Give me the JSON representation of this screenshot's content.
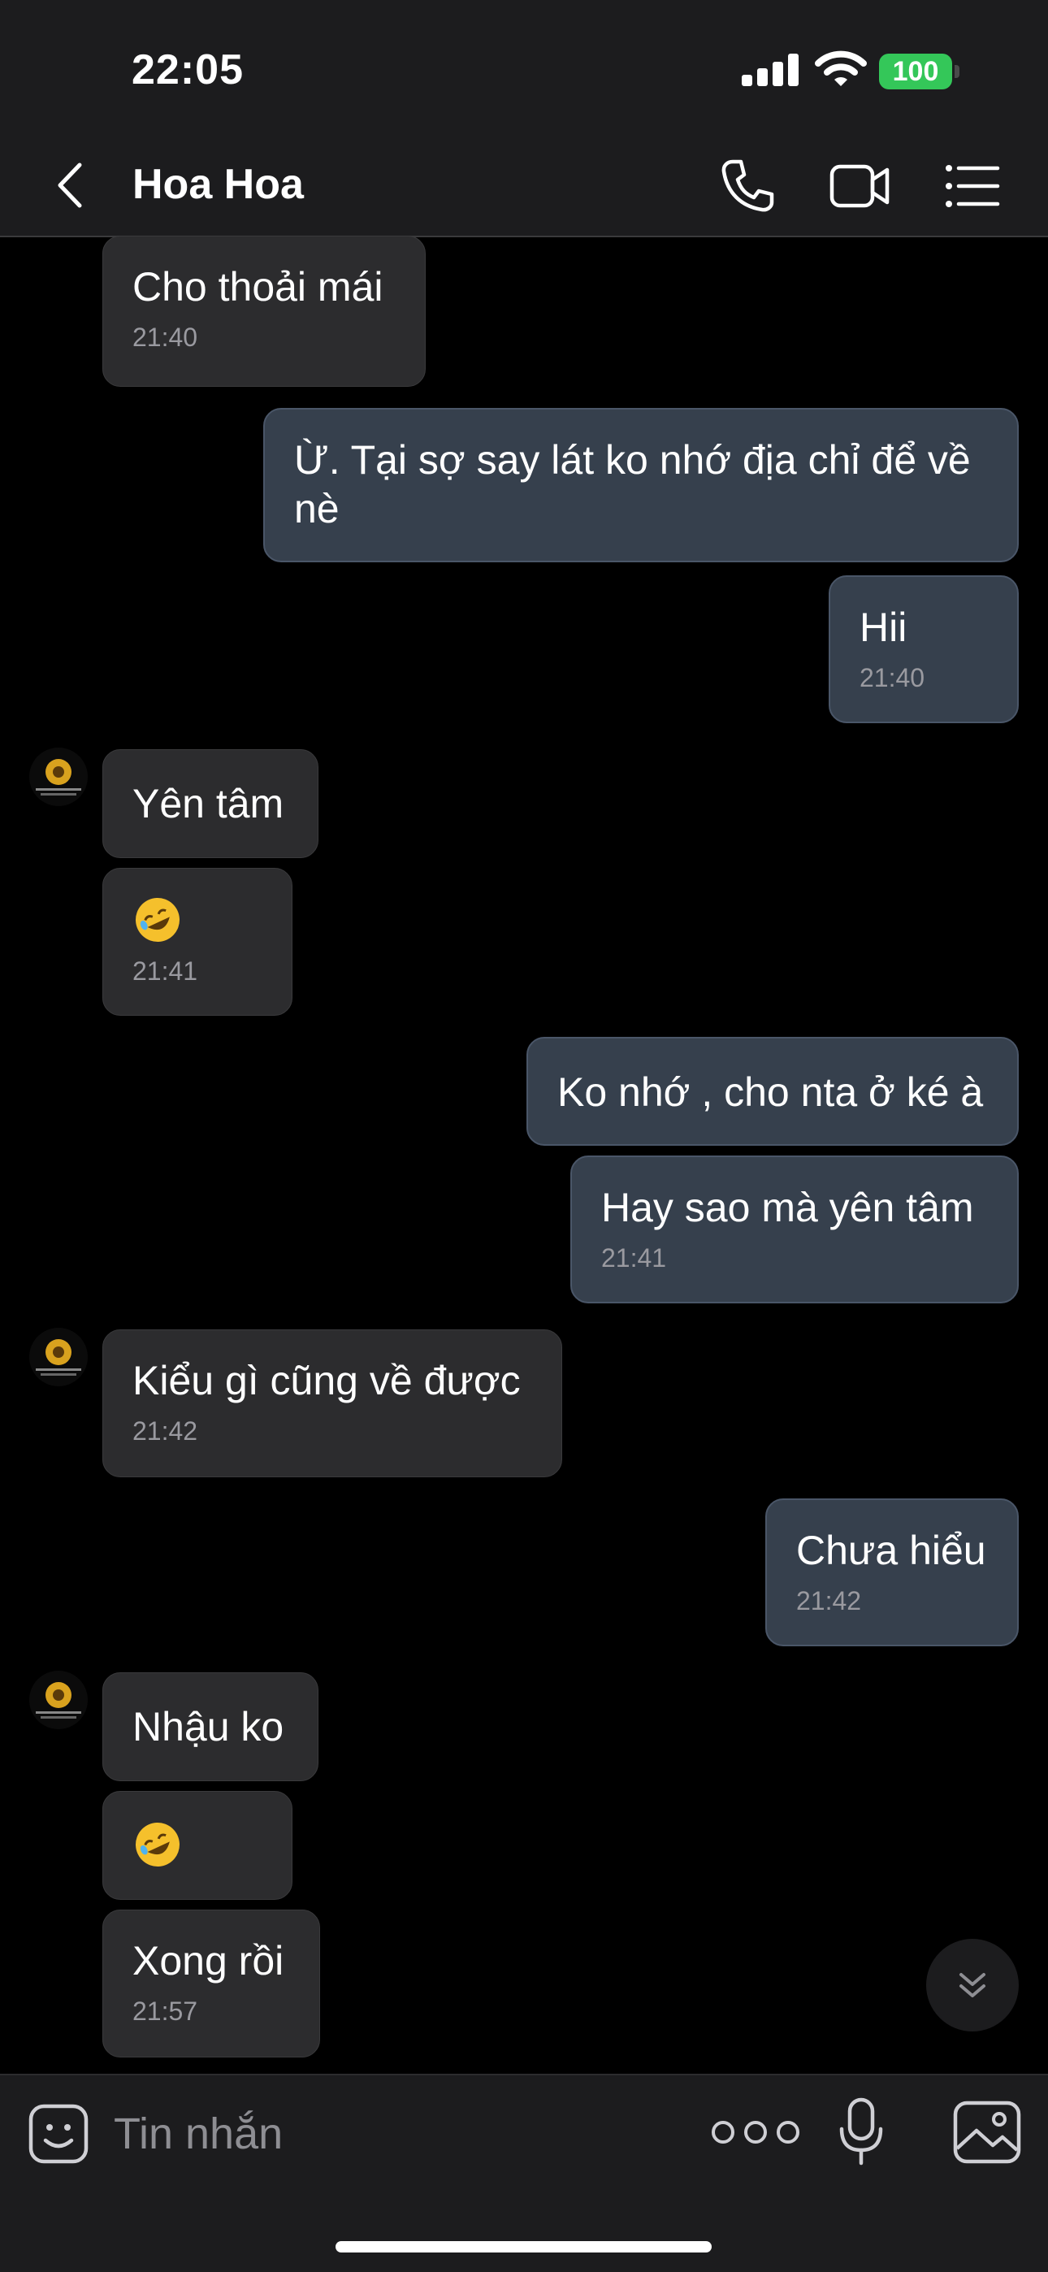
{
  "status_bar": {
    "time": "22:05",
    "battery": "100"
  },
  "header": {
    "contact_name": "Hoa Hoa"
  },
  "messages": [
    {
      "side": "in",
      "text": "Cho thoải mái",
      "time": "21:40"
    },
    {
      "side": "out",
      "text": "Ừ. Tại sợ say lát ko nhớ địa chỉ để về nè"
    },
    {
      "side": "out",
      "text": "Hii",
      "time": "21:40"
    },
    {
      "side": "in",
      "text": "Yên tâm"
    },
    {
      "side": "in",
      "emoji": "rolling-on-floor-laughing",
      "time": "21:41"
    },
    {
      "side": "out",
      "text": "Ko nhớ , cho nta ở ké à"
    },
    {
      "side": "out",
      "text": "Hay sao mà yên tâm",
      "time": "21:41"
    },
    {
      "side": "in",
      "text": "Kiểu gì cũng về được",
      "time": "21:42"
    },
    {
      "side": "out",
      "text": "Chưa hiểu",
      "time": "21:42"
    },
    {
      "side": "in",
      "text": "Nhậu ko"
    },
    {
      "side": "in",
      "emoji": "rolling-on-floor-laughing"
    },
    {
      "side": "in",
      "text": "Xong rồi",
      "time": "21:57"
    }
  ],
  "composer": {
    "placeholder": "Tin nhắn"
  },
  "colors": {
    "background": "#000000",
    "incoming_bubble": "#2c2c2e",
    "outgoing_bubble": "#36404d",
    "battery": "#34c759"
  }
}
